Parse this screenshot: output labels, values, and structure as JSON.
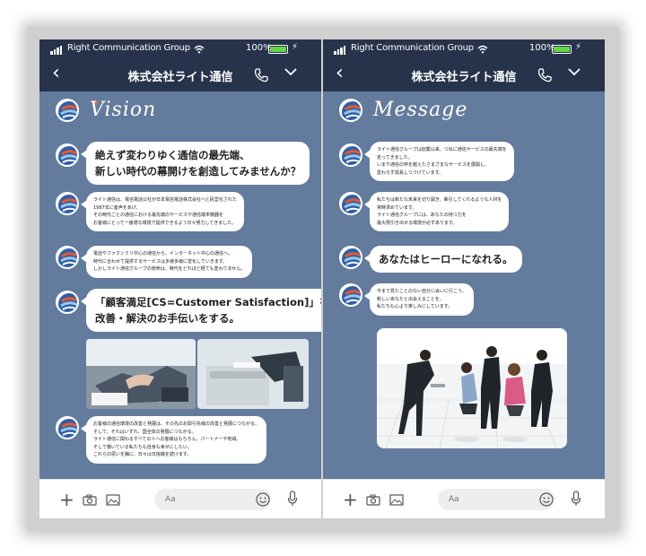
{
  "status": {
    "carrier": "Right Communication Group",
    "battery": "100%",
    "battery_level": 1.0
  },
  "nav": {
    "title": "株式会社ライト通信",
    "back_icon": "chevron-left-icon",
    "call_icon": "phone-icon",
    "menu_icon": "chevron-down-icon"
  },
  "composer": {
    "placeholder": "Aa"
  },
  "left": {
    "heading": "Vision",
    "messages": [
      {
        "lines": [
          "絶えず変わりゆく通信の最先端、",
          "新しい時代の幕開けを創造してみませんか？"
        ]
      },
      {
        "lines": [
          "ライト通信は、電信電話公社が日本電信電話株式会社へと民営化された",
          "1987年に産声をあげ、",
          "その時代ごとの通信における最先端のサービスや通信端末機器を",
          "お客様にとって一番適な環境で提供できるよう日々努力してきました。"
        ]
      },
      {
        "lines": [
          "電話やファクシミリ中心の通信から、インターネット中心の通信へ。",
          "時代に合わせて提供するサービスは多様多様に変化していきます。",
          "しかしライト通信グループの使命は、時代をどれほど経ても変わりません。"
        ]
      },
      {
        "lines": [
          "「顧客満足[CS=Customer Satisfaction]」を第一に、",
          "改善・解決のお手伝いをする。"
        ]
      },
      {
        "lines": [
          "お客様の通信環境の改善と発展は、その先のお取引先様の改善と発展につながる。",
          "そして、それはいずれ、国全体の発展につながる。",
          "ライト通信に関わるすべての人へお客様はもちろん、パートナーや地域、",
          "そして働いている私たちも自身も幸せにしたい。",
          "これらの思いを胸に、日々は日挑戦を続けます。"
        ]
      }
    ]
  },
  "right": {
    "heading": "Message",
    "messages": [
      {
        "lines": [
          "ライト通信グループは創業以来、つねに通信サービスの最先端を",
          "走ってきました。",
          "いまや通信の枠を越えたさまざまなサービスを展開し、",
          "変わらず成長しつづけています。"
        ]
      },
      {
        "lines": [
          "私たちは新たな未来を切り開き、牽引してくれるような人材を",
          "常時求めています。",
          "ライト通信グループには、あなたの持つ力を",
          "最大限引き出せる環境が必ずあります。"
        ]
      },
      {
        "lines": [
          "あなたはヒーローになれる。"
        ]
      },
      {
        "lines": [
          "今まで見たことのない自分に会いに行こう。",
          "新しいあなたと出会えることを、",
          "私たちも心より楽しみにしています。"
        ]
      }
    ]
  }
}
